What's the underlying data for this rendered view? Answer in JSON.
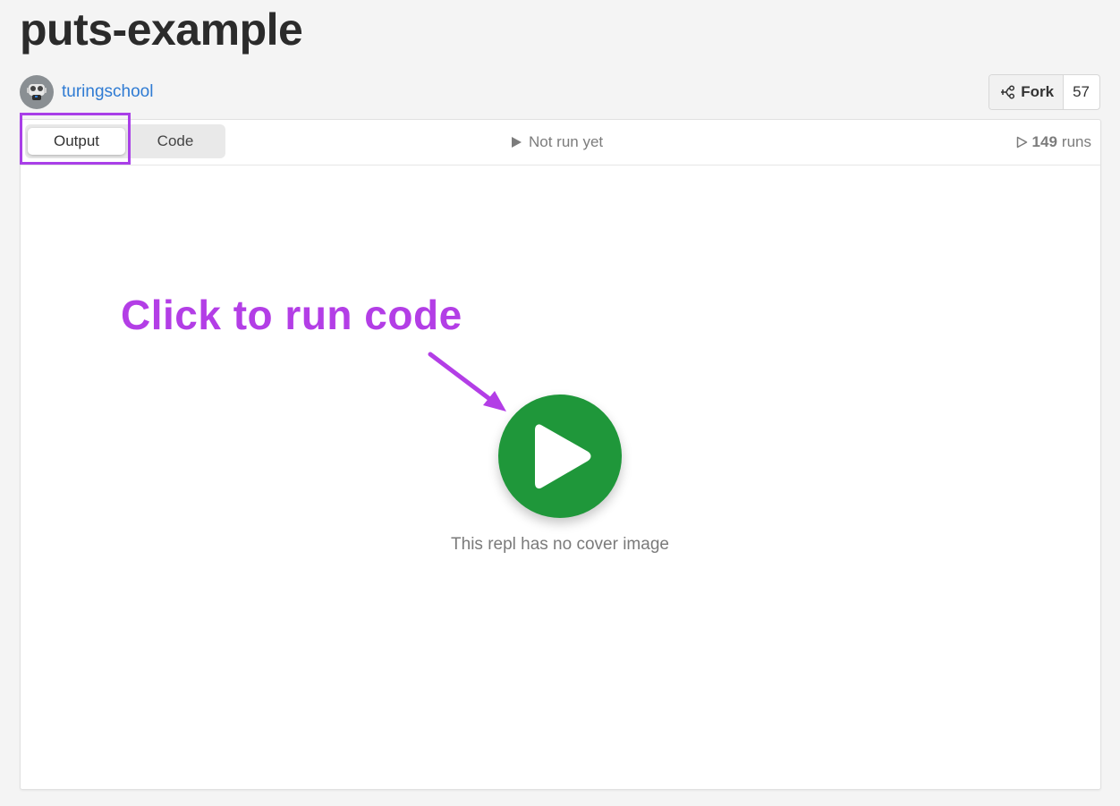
{
  "repl": {
    "title": "puts-example",
    "author": "turingschool"
  },
  "fork": {
    "label": "Fork",
    "count": "57"
  },
  "tabs": {
    "output_label": "Output",
    "code_label": "Code",
    "active": "Output"
  },
  "status": {
    "run_status": "Not run yet",
    "run_count": "149",
    "run_count_unit": "runs"
  },
  "annotation": {
    "text": "Click to run code",
    "color": "#b33ee6"
  },
  "player": {
    "play_color": "#1f973a",
    "cover_note": "This repl has no cover image"
  },
  "icons": {
    "avatar": "robot-avatar-icon",
    "fork": "fork-icon",
    "run_status": "play-triangle-icon",
    "run_count": "play-outline-icon",
    "play": "play-icon",
    "arrow": "arrow-icon"
  }
}
